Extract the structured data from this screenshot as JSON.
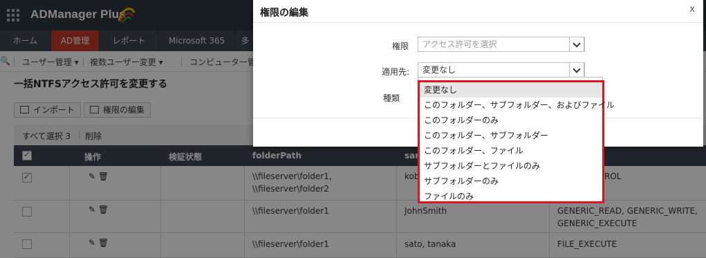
{
  "app": {
    "name": "ADManager Plus"
  },
  "tabs": [
    "ホーム",
    "AD管理",
    "レポート",
    "Microsoft 365",
    "多"
  ],
  "subnav": [
    "ユーザー管理",
    "複数ユーザー変更",
    "コンピューター管"
  ],
  "page": {
    "title": "一括NTFSアクセス許可を変更する"
  },
  "toolbar": {
    "import_label": "インポート",
    "edit_label": "権限の編集"
  },
  "selection": {
    "select_all": "すべて選択 3",
    "delete": "削除"
  },
  "table": {
    "headers": [
      "操作",
      "検証状態",
      "folderPath",
      "sam"
    ],
    "rows": [
      {
        "checked": true,
        "status": "",
        "path": "\\\\fileserver\\folder1,\n\\\\fileserver\\folder2",
        "sam": "kob",
        "perm": "ROL"
      },
      {
        "checked": false,
        "status": "",
        "path": "\\\\fileserver\\folder1",
        "sam": "JohnSmith",
        "perm": "GENERIC_READ, GENERIC_WRITE,\nGENERIC_EXECUTE"
      },
      {
        "checked": false,
        "status": "",
        "path": "\\\\fileserver\\folder1",
        "sam": "sato, tanaka",
        "perm": "FILE_EXECUTE"
      }
    ]
  },
  "modal": {
    "title": "権限の編集",
    "close": "x",
    "permission_label": "権限",
    "permission_placeholder": "アクセス許可を選択",
    "apply_label": "適用先:",
    "apply_value": "変更なし",
    "type_label": "種類"
  },
  "dropdown": {
    "highlight_color": "#e0141c",
    "options": [
      "変更なし",
      "このフォルダー、サブフォルダー、およびファイル",
      "このフォルダーのみ",
      "このフォルダー、サブフォルダー",
      "このフォルダー、ファイル",
      "サブフォルダーとファイルのみ",
      "サブフォルダーのみ",
      "ファイルのみ"
    ],
    "selected_index": 0
  },
  "colors": {
    "topbar": "#2f3841",
    "active_tab": "#c0392b",
    "table_header": "#3c4650"
  }
}
